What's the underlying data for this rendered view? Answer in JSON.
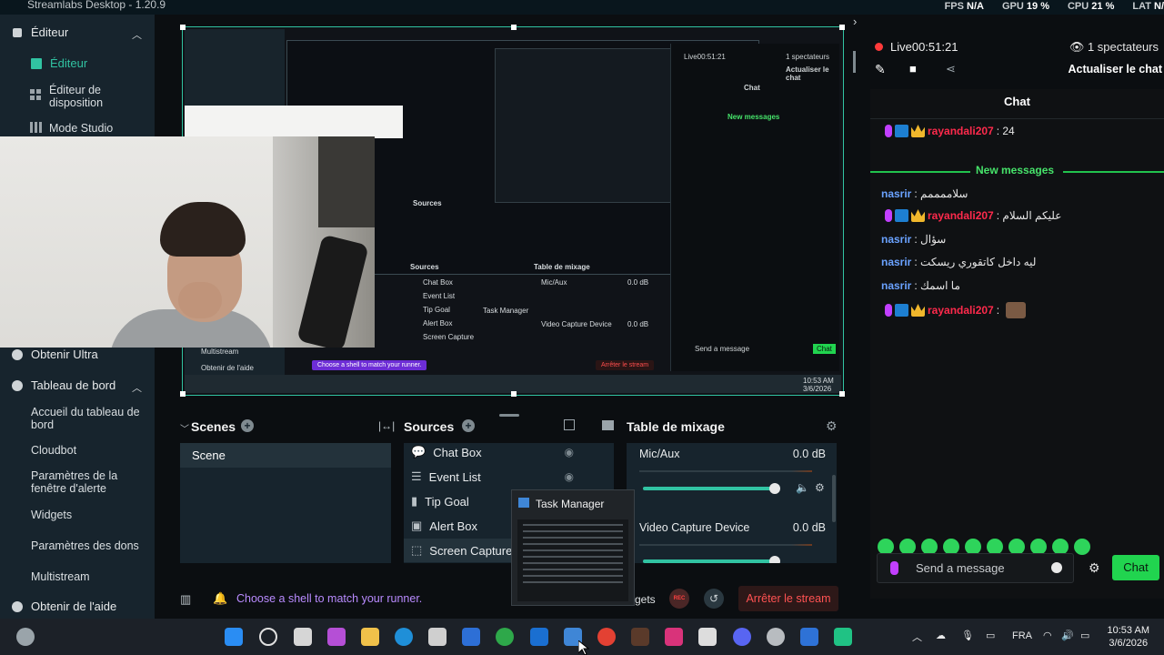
{
  "window": {
    "title": "Streamlabs Desktop - 1.20.9",
    "stats": [
      {
        "label": "FPS",
        "value": "N/A"
      },
      {
        "label": "GPU",
        "value": "19 %"
      },
      {
        "label": "CPU",
        "value": "21 %"
      },
      {
        "label": "LAT",
        "value": "N/"
      }
    ]
  },
  "sidebar": {
    "editor_group": "Éditeur",
    "editor_items": [
      "Éditeur",
      "Éditeur de disposition",
      "Mode Studio"
    ],
    "ultra": "Obtenir Ultra",
    "dashboard_group": "Tableau de bord",
    "dashboard_items": [
      "Accueil du tableau de bord",
      "Cloudbot",
      "Paramètres de la fenêtre d'alerte",
      "Widgets",
      "Paramètres des dons",
      "Multistream"
    ],
    "help": "Obtenir de l'aide"
  },
  "preview": {
    "mini_sources_title": "Sources",
    "mini_mixer_title": "Table de mixage",
    "mini_sources": [
      "Chat Box",
      "Event List",
      "Tip Goal",
      "Alert Box",
      "Screen Capture"
    ],
    "mini_mixer": [
      {
        "name": "Mic/Aux",
        "db": "0.0 dB"
      },
      {
        "name": "Video Capture Device",
        "db": "0.0 dB"
      }
    ],
    "mini_taskmgr": "Task Manager",
    "mini_runner": "Choose a shell to match your runner.",
    "mini_stop": "Arrêter le stream",
    "mini_multistream": "Multistream",
    "mini_help": "Obtenir de l'aide",
    "mini_live": "Live00:51:21",
    "mini_viewers": "1 spectateurs",
    "mini_refresh": "Actualiser le chat",
    "mini_chat": "Chat",
    "mini_new_messages": "New messages",
    "mini_send": "Send a message",
    "mini_chat_button": "Chat",
    "mini_clock": "10:53 AM",
    "mini_date": "3/6/2026"
  },
  "scenes": {
    "title": "Scenes",
    "items": [
      "Scene"
    ]
  },
  "sources": {
    "title": "Sources",
    "items": [
      {
        "label": "Chat Box",
        "icon": "chat-icon"
      },
      {
        "label": "Event List",
        "icon": "list-icon"
      },
      {
        "label": "Tip Goal",
        "icon": "tip-icon"
      },
      {
        "label": "Alert Box",
        "icon": "alert-icon"
      },
      {
        "label": "Screen Capture",
        "icon": "screen-icon"
      }
    ]
  },
  "mixer": {
    "title": "Table de mixage",
    "channels": [
      {
        "name": "Mic/Aux",
        "db": "0.0 dB",
        "level": 1.0
      },
      {
        "name": "Video Capture Device",
        "db": "0.0 dB",
        "level": 1.0
      }
    ]
  },
  "taskmgr": {
    "title": "Task Manager"
  },
  "footer": {
    "runner_text": "Choose a shell to match your runner.",
    "widgets": "gets",
    "rec": "REC",
    "stop": "Arrêter le stream"
  },
  "live": {
    "status": "Live00:51:21",
    "viewers": "1 spectateurs",
    "refresh": "Actualiser le chat"
  },
  "chat": {
    "title": "Chat",
    "first": {
      "user": "rayandali207",
      "text": ": 24"
    },
    "new_messages": "New messages",
    "messages": [
      {
        "user": "nasrir",
        "text": ": سلاممممم",
        "style": "blue"
      },
      {
        "user": "rayandali207",
        "text": ": عليكم السلام",
        "style": "red"
      },
      {
        "user": "nasrir",
        "text": ": سؤال",
        "style": "blue"
      },
      {
        "user": "nasrir",
        "text": ": ليه داخل كاتقوري ريسكت",
        "style": "blue"
      },
      {
        "user": "nasrir",
        "text": ": ما اسمك",
        "style": "blue"
      },
      {
        "user": "rayandali207",
        "text": ":",
        "style": "red"
      }
    ],
    "input_placeholder": "Send a message",
    "send_label": "Chat"
  },
  "taskbar": {
    "lang": "FRA",
    "time": "10:53 AM",
    "date": "3/6/2026"
  },
  "colors": {
    "accent": "#31c3a2",
    "live_red": "#ff3a3a",
    "chat_green": "#21d44f",
    "user_blue": "#6aa2ff",
    "user_red": "#ff2a4c"
  }
}
